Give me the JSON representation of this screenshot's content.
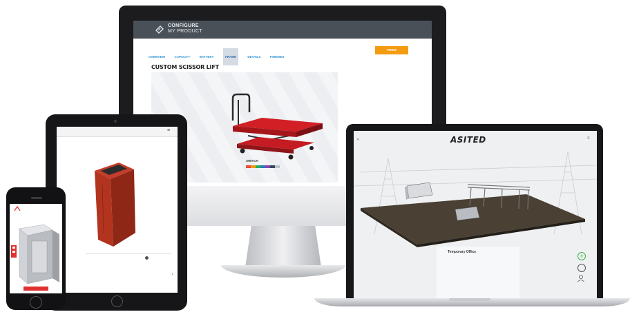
{
  "desktop": {
    "logo_line1": "CONFIGURE",
    "logo_line2": "MY PRODUCT",
    "nav": [
      "",
      "",
      ""
    ],
    "tabs": [
      "OVERVIEW",
      "CAPACITY",
      "BATTERY",
      "FRAME",
      "DETAILS",
      "FINISHES"
    ],
    "active_tab_index": 3,
    "price_label": "PRICE",
    "price_value": "",
    "product_title": "CUSTOM SCISSOR LIFT",
    "switch_label": "SWITCH",
    "swatch_colors": [
      "#e74c3c",
      "#f39c12",
      "#27ae60",
      "#2980b9",
      "#8e44ad",
      "#34495e",
      "#bdc3c7",
      "#ecf0f1"
    ],
    "accent_color": "#f39c12",
    "header_color": "#4a5057"
  },
  "tablet": {
    "back_label": "",
    "title": "",
    "menu_icon": "hamburger-icon",
    "rows": [
      {
        "label": "",
        "value": ""
      },
      {
        "label": "",
        "value": ""
      },
      {
        "label": "",
        "value": ""
      },
      {
        "label": "",
        "value": ""
      },
      {
        "label": "",
        "value": ""
      }
    ],
    "price_line1": "",
    "price_line2": ""
  },
  "phone": {
    "logo_text": "",
    "nav_left": "",
    "nav_mid": "",
    "nav_right": "",
    "button_label": ""
  },
  "laptop": {
    "logo": "ASITED",
    "panel_title": "Temporary Office",
    "fields": [
      "",
      "",
      "",
      ""
    ],
    "icons": [
      "add-icon",
      "settings-icon",
      "user-icon"
    ],
    "accent_color": "#3cb44b"
  }
}
